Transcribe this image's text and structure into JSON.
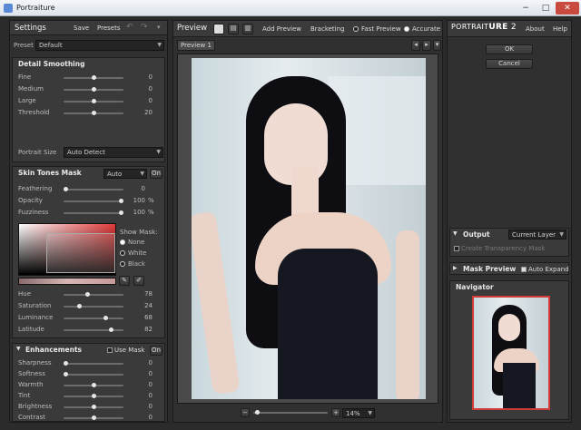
{
  "window": {
    "title": "Portraiture",
    "minimize": "−",
    "maximize": "□",
    "close": "✕"
  },
  "settings": {
    "title": "Settings",
    "save": "Save",
    "presets": "Presets",
    "preset_label": "Preset",
    "preset_value": "Default"
  },
  "detail": {
    "title": "Detail Smoothing",
    "sliders": [
      {
        "label": "Fine",
        "value": "0",
        "frac": 0.5
      },
      {
        "label": "Medium",
        "value": "0",
        "frac": 0.5
      },
      {
        "label": "Large",
        "value": "0",
        "frac": 0.5
      },
      {
        "label": "Threshold",
        "value": "20",
        "frac": 0.5
      }
    ],
    "portrait_size_label": "Portrait Size",
    "portrait_size_value": "Auto Detect"
  },
  "skin": {
    "title": "Skin Tones Mask",
    "mode": "Auto",
    "on": "On",
    "sliders": [
      {
        "label": "Feathering",
        "value": "0",
        "unit": "",
        "frac": 0.0
      },
      {
        "label": "Opacity",
        "value": "100",
        "unit": "%",
        "frac": 1.0
      },
      {
        "label": "Fuzziness",
        "value": "100",
        "unit": "%",
        "frac": 1.0
      }
    ],
    "show_mask_label": "Show Mask:",
    "mask_options": [
      {
        "label": "None",
        "selected": true
      },
      {
        "label": "White",
        "selected": false
      },
      {
        "label": "Black",
        "selected": false
      }
    ],
    "color_sliders": [
      {
        "label": "Hue",
        "value": "78",
        "frac": 0.4
      },
      {
        "label": "Saturation",
        "value": "24",
        "frac": 0.25
      },
      {
        "label": "Luminance",
        "value": "68",
        "frac": 0.72
      },
      {
        "label": "Latitude",
        "value": "82",
        "frac": 0.82
      }
    ]
  },
  "enhance": {
    "title": "Enhancements",
    "use_mask": "Use Mask",
    "on": "On",
    "sliders": [
      {
        "label": "Sharpness",
        "value": "0",
        "frac": 0.0
      },
      {
        "label": "Softness",
        "value": "0",
        "frac": 0.0
      },
      {
        "label": "Warmth",
        "value": "0",
        "frac": 0.5
      },
      {
        "label": "Tint",
        "value": "0",
        "frac": 0.5
      },
      {
        "label": "Brightness",
        "value": "0",
        "frac": 0.5
      },
      {
        "label": "Contrast",
        "value": "0",
        "frac": 0.5
      }
    ]
  },
  "preview": {
    "title": "Preview",
    "add_preview": "Add Preview",
    "bracketing": "Bracketing",
    "fast_preview": "Fast Preview",
    "accurate": "Accurate",
    "tab": "Preview 1",
    "zoom": "14%"
  },
  "right": {
    "logo_a": "PORTRAIT",
    "logo_b": "URE",
    "logo_ver": "2",
    "about": "About",
    "help": "Help",
    "ok": "OK",
    "cancel": "Cancel",
    "output_title": "Output",
    "output_value": "Current Layer",
    "create_transparency": "Create Transparency Mask",
    "mask_preview": "Mask Preview",
    "auto_expand": "Auto Expand",
    "navigator": "Navigator"
  },
  "colors": {
    "accent_red": "#d23a3a",
    "panel": "#303030",
    "header": "#3a3a3a"
  }
}
